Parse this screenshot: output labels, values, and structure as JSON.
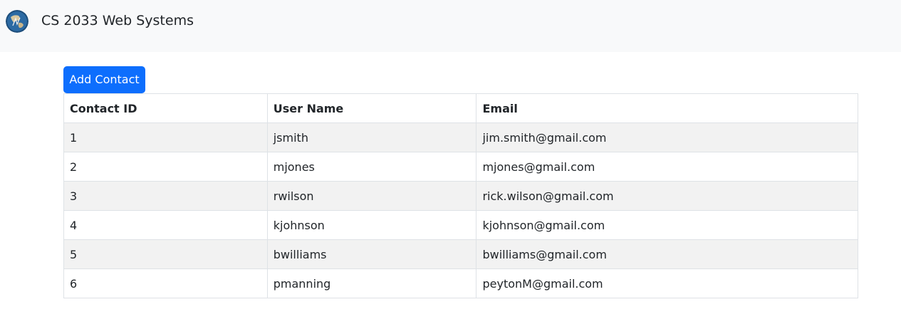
{
  "navbar": {
    "brand": "CS 2033 Web Systems",
    "logo_icon": "globe-logo-icon"
  },
  "actions": {
    "add_contact_label": "Add Contact",
    "accent_color": "#0d6efd"
  },
  "table": {
    "headers": [
      "Contact ID",
      "User Name",
      "Email"
    ],
    "rows": [
      [
        "1",
        "jsmith",
        "jim.smith@gmail.com"
      ],
      [
        "2",
        "mjones",
        "mjones@gmail.com"
      ],
      [
        "3",
        "rwilson",
        "rick.wilson@gmail.com"
      ],
      [
        "4",
        "kjohnson",
        "kjohnson@gmail.com"
      ],
      [
        "5",
        "bwilliams",
        "bwilliams@gmail.com"
      ],
      [
        "6",
        "pmanning",
        "peytonM@gmail.com"
      ]
    ]
  }
}
